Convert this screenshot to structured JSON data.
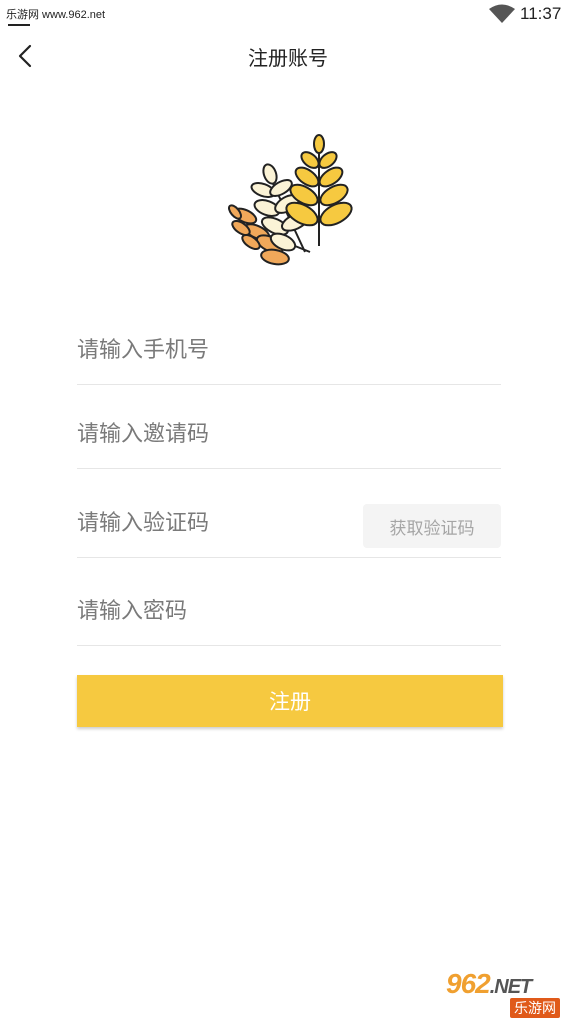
{
  "status_bar": {
    "left_text": "乐游网 www.962.net",
    "time": "11:37",
    "wifi_icon": "wifi-icon"
  },
  "header": {
    "back_icon": "chevron-left-icon",
    "title": "注册账号"
  },
  "logo": {
    "icon": "wheat-icon",
    "colors": {
      "gold": "#f6c940",
      "orange": "#f0a85a",
      "cream": "#fbf3d6"
    }
  },
  "form": {
    "phone_placeholder": "请输入手机号",
    "invite_placeholder": "请输入邀请码",
    "code_placeholder": "请输入验证码",
    "get_code_label": "获取验证码",
    "password_placeholder": "请输入密码",
    "register_label": "注册"
  },
  "colors": {
    "accent": "#f6c940",
    "divider": "#e6e6e6",
    "placeholder": "#7a7a7a"
  },
  "watermark": {
    "top_text": "962",
    "top_suffix": ".NET",
    "bottom_text": "乐游网"
  }
}
